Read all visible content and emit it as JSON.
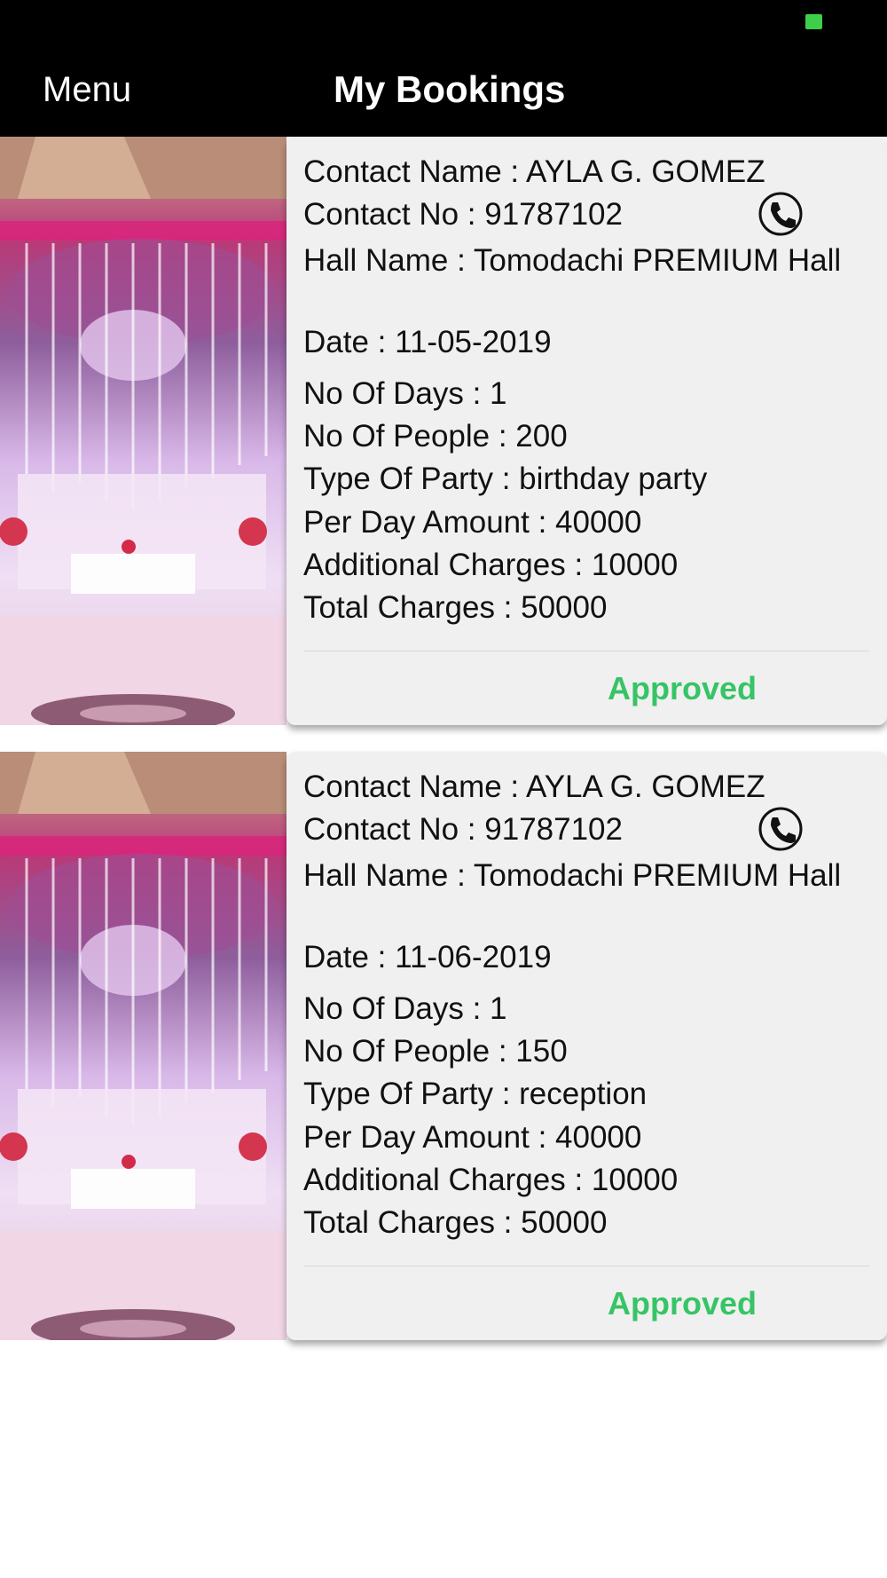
{
  "nav": {
    "menu_label": "Menu",
    "title": "My Bookings"
  },
  "bookings": [
    {
      "contact_name": "Contact Name : AYLA G. GOMEZ",
      "contact_no": "Contact No : 91787102",
      "hall_name": "Hall Name : Tomodachi PREMIUM Hall",
      "date": "Date : 11-05-2019",
      "days": "No Of Days : 1",
      "people": "No Of People : 200",
      "party_type": "Type Of Party : birthday party",
      "per_day_amount": "Per Day Amount : 40000",
      "additional_charges": "Additional Charges : 10000",
      "total_charges": "Total Charges : 50000",
      "status": "Approved",
      "icon": "phone-icon"
    },
    {
      "contact_name": "Contact Name : AYLA G. GOMEZ",
      "contact_no": "Contact No : 91787102",
      "hall_name": "Hall Name : Tomodachi PREMIUM Hall",
      "date": "Date : 11-06-2019",
      "days": "No Of Days : 1",
      "people": "No Of People : 150",
      "party_type": "Type Of Party : reception",
      "per_day_amount": "Per Day Amount : 40000",
      "additional_charges": "Additional Charges : 10000",
      "total_charges": "Total Charges : 50000",
      "status": "Approved",
      "icon": "phone-icon"
    }
  ],
  "colors": {
    "status_approved": "#37c466",
    "bar": "#000000",
    "card": "#f0f0f0"
  }
}
